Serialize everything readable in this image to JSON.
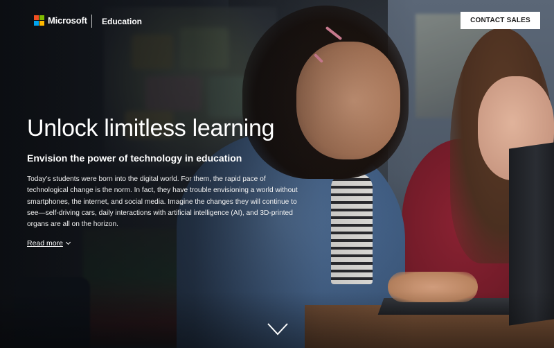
{
  "header": {
    "brand_name": "Microsoft",
    "section_label": "Education",
    "contact_label": "CONTACT SALES"
  },
  "logo": {
    "colors": [
      "#f25022",
      "#7fba00",
      "#00a4ef",
      "#ffb900"
    ]
  },
  "hero": {
    "title": "Unlock limitless learning",
    "subtitle": "Envision the power of technology in education",
    "body": "Today’s students were born into the digital world. For them, the rapid pace of technological change is the norm. In fact, they have trouble envisioning a world without smartphones, the internet, and social media. Imagine the changes they will continue to see—self-driving cars, daily interactions with artificial intelligence (AI), and 3D-printed organs are all on the horizon.",
    "read_more_label": "Read more",
    "read_more_icon": "chevron-down-icon",
    "scroll_icon": "chevron-down-icon"
  },
  "colors": {
    "text": "#ffffff",
    "button_bg": "#ffffff",
    "button_text": "#1a1a1a"
  }
}
